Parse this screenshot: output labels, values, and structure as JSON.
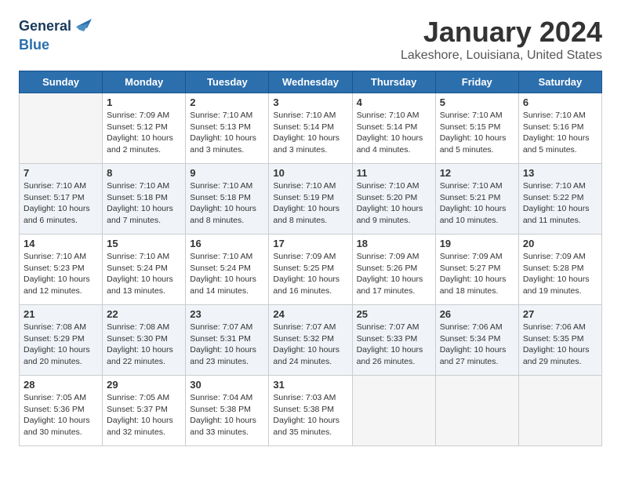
{
  "header": {
    "logo_line1": "General",
    "logo_line2": "Blue",
    "title": "January 2024",
    "subtitle": "Lakeshore, Louisiana, United States"
  },
  "weekdays": [
    "Sunday",
    "Monday",
    "Tuesday",
    "Wednesday",
    "Thursday",
    "Friday",
    "Saturday"
  ],
  "weeks": [
    [
      {
        "day": null,
        "info": null
      },
      {
        "day": "1",
        "info": "Sunrise: 7:09 AM\nSunset: 5:12 PM\nDaylight: 10 hours\nand 2 minutes."
      },
      {
        "day": "2",
        "info": "Sunrise: 7:10 AM\nSunset: 5:13 PM\nDaylight: 10 hours\nand 3 minutes."
      },
      {
        "day": "3",
        "info": "Sunrise: 7:10 AM\nSunset: 5:14 PM\nDaylight: 10 hours\nand 3 minutes."
      },
      {
        "day": "4",
        "info": "Sunrise: 7:10 AM\nSunset: 5:14 PM\nDaylight: 10 hours\nand 4 minutes."
      },
      {
        "day": "5",
        "info": "Sunrise: 7:10 AM\nSunset: 5:15 PM\nDaylight: 10 hours\nand 5 minutes."
      },
      {
        "day": "6",
        "info": "Sunrise: 7:10 AM\nSunset: 5:16 PM\nDaylight: 10 hours\nand 5 minutes."
      }
    ],
    [
      {
        "day": "7",
        "info": "Sunrise: 7:10 AM\nSunset: 5:17 PM\nDaylight: 10 hours\nand 6 minutes."
      },
      {
        "day": "8",
        "info": "Sunrise: 7:10 AM\nSunset: 5:18 PM\nDaylight: 10 hours\nand 7 minutes."
      },
      {
        "day": "9",
        "info": "Sunrise: 7:10 AM\nSunset: 5:18 PM\nDaylight: 10 hours\nand 8 minutes."
      },
      {
        "day": "10",
        "info": "Sunrise: 7:10 AM\nSunset: 5:19 PM\nDaylight: 10 hours\nand 8 minutes."
      },
      {
        "day": "11",
        "info": "Sunrise: 7:10 AM\nSunset: 5:20 PM\nDaylight: 10 hours\nand 9 minutes."
      },
      {
        "day": "12",
        "info": "Sunrise: 7:10 AM\nSunset: 5:21 PM\nDaylight: 10 hours\nand 10 minutes."
      },
      {
        "day": "13",
        "info": "Sunrise: 7:10 AM\nSunset: 5:22 PM\nDaylight: 10 hours\nand 11 minutes."
      }
    ],
    [
      {
        "day": "14",
        "info": "Sunrise: 7:10 AM\nSunset: 5:23 PM\nDaylight: 10 hours\nand 12 minutes."
      },
      {
        "day": "15",
        "info": "Sunrise: 7:10 AM\nSunset: 5:24 PM\nDaylight: 10 hours\nand 13 minutes."
      },
      {
        "day": "16",
        "info": "Sunrise: 7:10 AM\nSunset: 5:24 PM\nDaylight: 10 hours\nand 14 minutes."
      },
      {
        "day": "17",
        "info": "Sunrise: 7:09 AM\nSunset: 5:25 PM\nDaylight: 10 hours\nand 16 minutes."
      },
      {
        "day": "18",
        "info": "Sunrise: 7:09 AM\nSunset: 5:26 PM\nDaylight: 10 hours\nand 17 minutes."
      },
      {
        "day": "19",
        "info": "Sunrise: 7:09 AM\nSunset: 5:27 PM\nDaylight: 10 hours\nand 18 minutes."
      },
      {
        "day": "20",
        "info": "Sunrise: 7:09 AM\nSunset: 5:28 PM\nDaylight: 10 hours\nand 19 minutes."
      }
    ],
    [
      {
        "day": "21",
        "info": "Sunrise: 7:08 AM\nSunset: 5:29 PM\nDaylight: 10 hours\nand 20 minutes."
      },
      {
        "day": "22",
        "info": "Sunrise: 7:08 AM\nSunset: 5:30 PM\nDaylight: 10 hours\nand 22 minutes."
      },
      {
        "day": "23",
        "info": "Sunrise: 7:07 AM\nSunset: 5:31 PM\nDaylight: 10 hours\nand 23 minutes."
      },
      {
        "day": "24",
        "info": "Sunrise: 7:07 AM\nSunset: 5:32 PM\nDaylight: 10 hours\nand 24 minutes."
      },
      {
        "day": "25",
        "info": "Sunrise: 7:07 AM\nSunset: 5:33 PM\nDaylight: 10 hours\nand 26 minutes."
      },
      {
        "day": "26",
        "info": "Sunrise: 7:06 AM\nSunset: 5:34 PM\nDaylight: 10 hours\nand 27 minutes."
      },
      {
        "day": "27",
        "info": "Sunrise: 7:06 AM\nSunset: 5:35 PM\nDaylight: 10 hours\nand 29 minutes."
      }
    ],
    [
      {
        "day": "28",
        "info": "Sunrise: 7:05 AM\nSunset: 5:36 PM\nDaylight: 10 hours\nand 30 minutes."
      },
      {
        "day": "29",
        "info": "Sunrise: 7:05 AM\nSunset: 5:37 PM\nDaylight: 10 hours\nand 32 minutes."
      },
      {
        "day": "30",
        "info": "Sunrise: 7:04 AM\nSunset: 5:38 PM\nDaylight: 10 hours\nand 33 minutes."
      },
      {
        "day": "31",
        "info": "Sunrise: 7:03 AM\nSunset: 5:38 PM\nDaylight: 10 hours\nand 35 minutes."
      },
      {
        "day": null,
        "info": null
      },
      {
        "day": null,
        "info": null
      },
      {
        "day": null,
        "info": null
      }
    ]
  ]
}
